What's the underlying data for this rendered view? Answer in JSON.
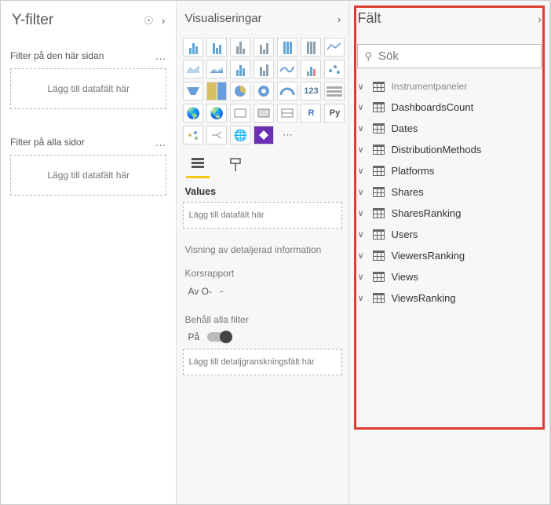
{
  "filters": {
    "title": "Y-filter",
    "section_page": "Filter på den här sidan",
    "section_all": "Filter på alla sidor",
    "drop_here": "Lägg till datafält här"
  },
  "viz": {
    "title": "Visualiseringar",
    "values_label": "Values",
    "drop_here": "Lägg till datafält här",
    "drill_section": "Visning av detaljerad information",
    "cross_report": "Korsrapport",
    "cross_report_value": "Av O-",
    "keep_filters": "Behåll alla filter",
    "keep_filters_value": "På",
    "drill_drop": "Lägg till detaljgranskningsfält här"
  },
  "fields": {
    "title": "Fält",
    "search_placeholder": "Sök",
    "tables": [
      "Instrumentpaneler",
      "DashboardsCount",
      "Dates",
      "DistributionMethods",
      "Platforms",
      "Shares",
      "SharesRanking",
      "Users",
      "ViewersRanking",
      "Views",
      "ViewsRanking"
    ]
  }
}
